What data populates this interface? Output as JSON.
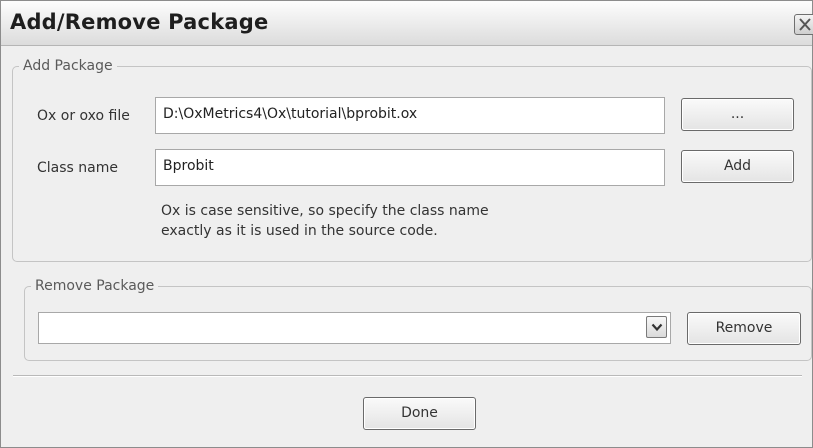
{
  "window": {
    "title": "Add/Remove Package",
    "close_icon": "close-icon"
  },
  "add_package": {
    "legend": "Add Package",
    "ox_file_label": "Ox or oxo file",
    "ox_file_value": "D:\\OxMetrics4\\Ox\\tutorial\\bprobit.ox",
    "browse_label": "...",
    "class_name_label": "Class name",
    "class_name_value": "Bprobit",
    "add_label": "Add",
    "note_line1": "Ox is case sensitive, so specify the class name",
    "note_line2": "exactly as it is used in the source code."
  },
  "remove_package": {
    "legend": "Remove Package",
    "selected_value": "",
    "dropdown_icon": "chevron-down-icon",
    "remove_label": "Remove"
  },
  "footer": {
    "done_label": "Done"
  }
}
